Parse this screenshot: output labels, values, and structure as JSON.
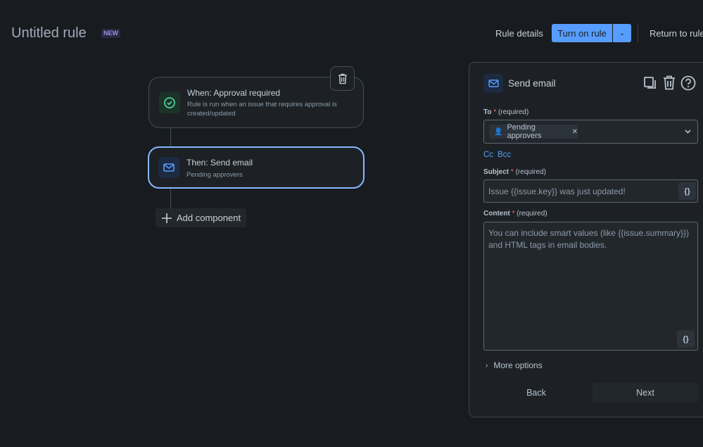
{
  "header": {
    "title": "Untitled rule",
    "badge": "NEW",
    "rule_details": "Rule details",
    "turn_on": "Turn on rule",
    "return": "Return to rules"
  },
  "canvas": {
    "trigger": {
      "title": "When: Approval required",
      "desc": "Rule is run when an issue that requires approval is created/updated"
    },
    "action": {
      "title": "Then: Send email",
      "desc": "Pending approvers"
    },
    "add_component": "Add component"
  },
  "panel": {
    "title": "Send email",
    "to_label": "To",
    "required": "(required)",
    "asterisk": "*",
    "to_chip": "Pending approvers",
    "cc": "Cc",
    "bcc": "Bcc",
    "subject_label": "Subject",
    "subject_placeholder": "Issue {{issue.key}} was just updated!",
    "content_label": "Content",
    "content_placeholder": "You can include smart values (like {{issue.summary}}) and HTML tags in email bodies.",
    "smart_values_glyph": "{}",
    "more_options": "More options",
    "back": "Back",
    "next": "Next"
  },
  "colors": {
    "accent": "#579dff",
    "bg": "#181b1f",
    "success": "#4bce97"
  }
}
